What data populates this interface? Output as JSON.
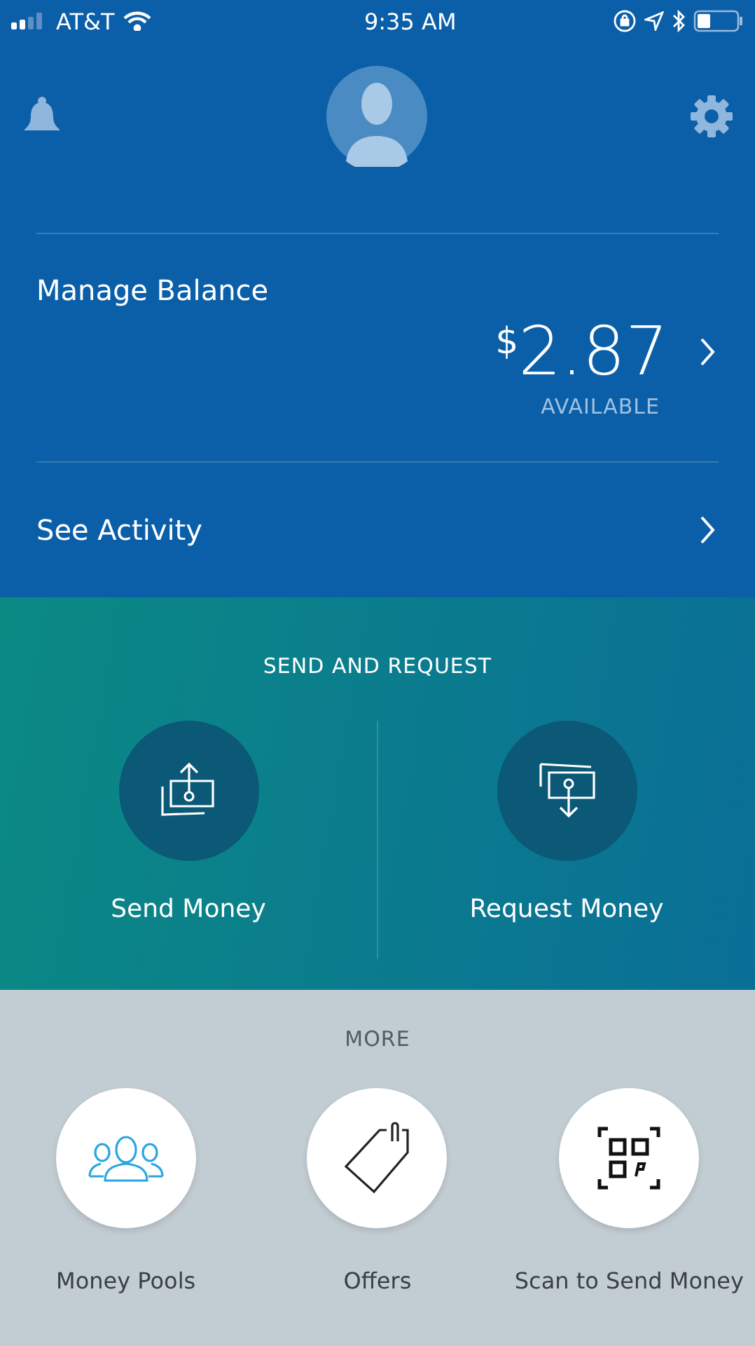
{
  "status_bar": {
    "carrier": "AT&T",
    "time": "9:35 AM"
  },
  "balance": {
    "title": "Manage Balance",
    "currency": "$",
    "amount": "2.87",
    "caption": "AVAILABLE"
  },
  "activity": {
    "label": "See Activity"
  },
  "send_request": {
    "title": "SEND AND REQUEST",
    "actions": [
      {
        "kind": "send",
        "label": "Send Money"
      },
      {
        "kind": "request",
        "label": "Request Money"
      }
    ]
  },
  "more": {
    "title": "MORE",
    "items": [
      {
        "kind": "pools",
        "label": "Money Pools"
      },
      {
        "kind": "offers",
        "label": "Offers"
      },
      {
        "kind": "scan",
        "label": "Scan to Send Money"
      }
    ]
  }
}
